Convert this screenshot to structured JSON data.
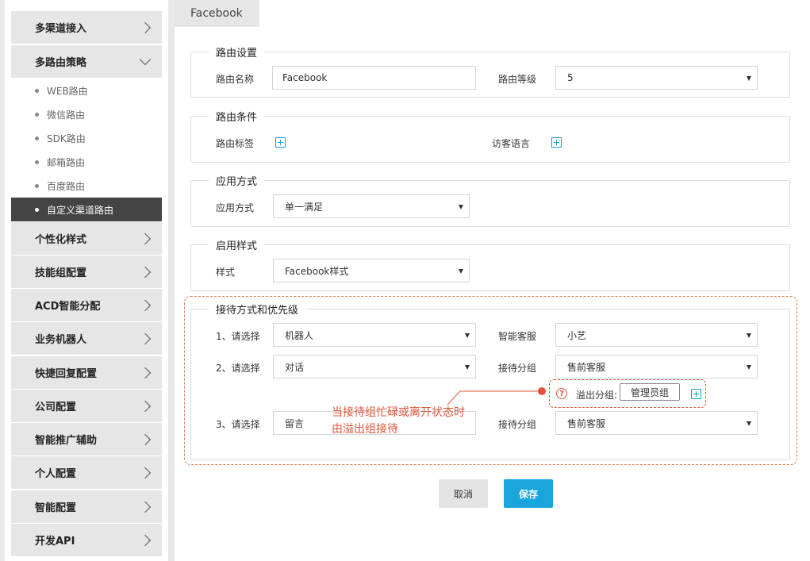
{
  "sidebar": {
    "items": [
      {
        "label": "多渠道接入"
      },
      {
        "label": "多路由策略"
      },
      {
        "label": "个性化样式"
      },
      {
        "label": "技能组配置"
      },
      {
        "label": "ACD智能分配"
      },
      {
        "label": "业务机器人"
      },
      {
        "label": "快捷回复配置"
      },
      {
        "label": "公司配置"
      },
      {
        "label": "智能推广辅助"
      },
      {
        "label": "个人配置"
      },
      {
        "label": "智能配置"
      },
      {
        "label": "开发API"
      }
    ],
    "subitems": [
      {
        "label": "WEB路由"
      },
      {
        "label": "微信路由"
      },
      {
        "label": "SDK路由"
      },
      {
        "label": "邮箱路由"
      },
      {
        "label": "百度路由"
      },
      {
        "label": "自定义渠道路由"
      }
    ]
  },
  "tab": {
    "label": "Facebook"
  },
  "route_settings": {
    "legend": "路由设置",
    "name_label": "路由名称",
    "name_value": "Facebook",
    "level_label": "路由等级",
    "level_value": "5"
  },
  "route_conditions": {
    "legend": "路由条件",
    "tag_label": "路由标签",
    "lang_label": "访客语言"
  },
  "apply_mode": {
    "legend": "应用方式",
    "label": "应用方式",
    "value": "单一满足"
  },
  "style": {
    "legend": "启用样式",
    "label": "样式",
    "value": "Facebook样式"
  },
  "reception": {
    "legend": "接待方式和优先级",
    "rows": [
      {
        "select_label": "1、请选择",
        "select_value": "机器人",
        "right_label": "智能客服",
        "right_value": "小艺"
      },
      {
        "select_label": "2、请选择",
        "select_value": "对话",
        "right_label": "接待分组",
        "right_value": "售前客服"
      },
      {
        "select_label": "3、请选择",
        "select_value": "留言",
        "right_label": "接待分组",
        "right_value": "售前客服"
      }
    ],
    "overflow_label": "溢出分组:",
    "overflow_value": "管理员组",
    "help_glyph": "?"
  },
  "annotation": {
    "line1": "当接待组忙碌或离开状态时",
    "line2": "由溢出组接待",
    "color": "#e0553a"
  },
  "buttons": {
    "cancel": "取消",
    "save": "保存"
  },
  "colors": {
    "accent": "#1aa6dd",
    "annotation": "#e0553a",
    "active_nav": "#444444"
  }
}
